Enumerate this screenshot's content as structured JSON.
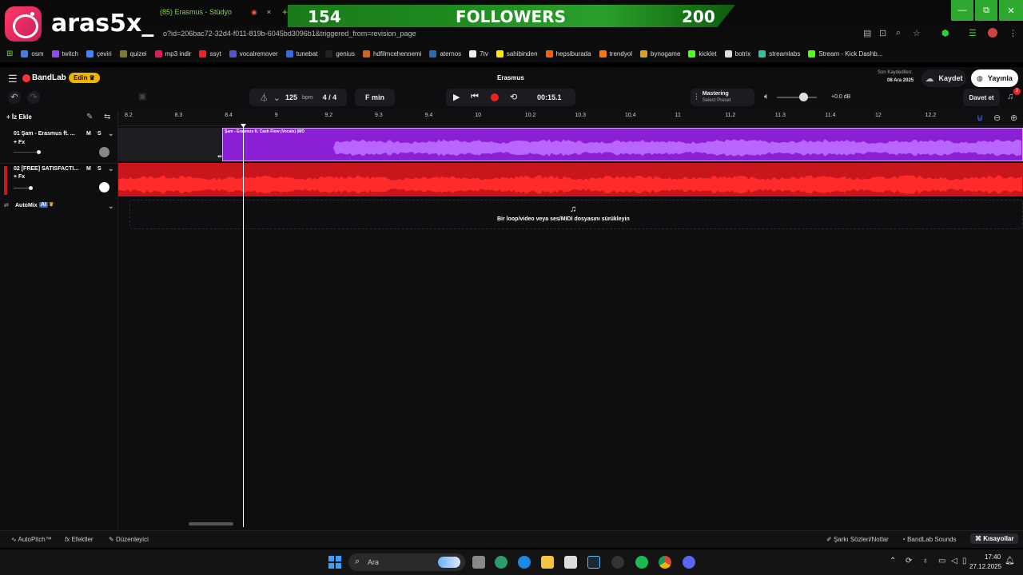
{
  "browser": {
    "tab_title": "(85) Erasmus - Stüdyo",
    "url": "o?id=206bac72-32d4-f011-819b-6045bd3096b1&triggered_from=revision_page",
    "new_tab": "+",
    "tab_close": "×",
    "min": "—",
    "max": "⧉",
    "close": "✕"
  },
  "overlay": {
    "ig_name": "aras5x_",
    "followers_current": "154",
    "followers_label": "FOLLOWERS",
    "followers_goal": "200"
  },
  "bookmarks": [
    {
      "label": "osm",
      "color": "#4a7bd8"
    },
    {
      "label": "twitch",
      "color": "#9146ff"
    },
    {
      "label": "çeviri",
      "color": "#4285f4"
    },
    {
      "label": "quizei",
      "color": "#7a7a3a"
    },
    {
      "label": "mp3 indir",
      "color": "#d81e5b"
    },
    {
      "label": "ssyt",
      "color": "#e22"
    },
    {
      "label": "vocalremover",
      "color": "#5a4fcf"
    },
    {
      "label": "tunebat",
      "color": "#3a6bd8"
    },
    {
      "label": "genius",
      "color": "#222"
    },
    {
      "label": "hdfilmcehennemi",
      "color": "#c62"
    },
    {
      "label": "aternos",
      "color": "#2a6bb8"
    },
    {
      "label": "7tv",
      "color": "#eee"
    },
    {
      "label": "sahibinden",
      "color": "#ffe800"
    },
    {
      "label": "hepsiburada",
      "color": "#ff6000"
    },
    {
      "label": "trendyol",
      "color": "#f27a1a"
    },
    {
      "label": "bynogame",
      "color": "#d8a020"
    },
    {
      "label": "kicklet",
      "color": "#53fc18"
    },
    {
      "label": "botrix",
      "color": "#ddd"
    },
    {
      "label": "streamlabs",
      "color": "#31c3a2"
    },
    {
      "label": "Stream - Kick Dashb...",
      "color": "#53fc18"
    }
  ],
  "header": {
    "logo": "BandLab",
    "edit_badge": "Edin",
    "project_title": "Erasmus",
    "last_saved_label": "Son Kaydedilen:",
    "last_saved_date": "08 Ara 2025",
    "save_button": "Kaydet",
    "publish_button": "Yayınla"
  },
  "toolbar": {
    "bpm_value": "125",
    "bpm_unit": "bpm",
    "time_sig": "4 / 4",
    "key": "F min",
    "time": "00:15.1",
    "mastering_title": "Mastering",
    "mastering_preset": "Select Preset",
    "volume_db": "+0.0 dB",
    "invite_button": "Davet et",
    "notif_count": "2"
  },
  "ruler": [
    "8.2",
    "8.3",
    "8.4",
    "9",
    "9.2",
    "9.3",
    "9.4",
    "10",
    "10.2",
    "10.3",
    "10.4",
    "11",
    "11.2",
    "11.3",
    "11.4",
    "12",
    "12.2"
  ],
  "tracks": {
    "add_track": "İz Ekle",
    "items": [
      {
        "name": "01 Şam - Erasmus ft. ...",
        "fx": "+ Fx",
        "mute": "M",
        "solo": "S",
        "color": "#8a1fd6",
        "volume": 0.45
      },
      {
        "name": "02 [FREE] SATISFACTI...",
        "fx": "+ Fx",
        "mute": "M",
        "solo": "S",
        "color": "#c8161c",
        "volume": 0.3
      }
    ],
    "automix_label": "AutoMix",
    "automix_badge": "AI"
  },
  "clips": {
    "clip1_title": "Şam - Erasmus ft. Cash Flow (Vocals) (MD"
  },
  "dropzone": {
    "text": "Bir loop/video veya ses/MIDI dosyasını sürükleyin"
  },
  "footer": {
    "autopitch": "AutoPitch™",
    "effects": "Efektler",
    "editor": "Düzenleyici",
    "lyrics": "Şarkı Sözleri/Notlar",
    "sounds": "BandLab Sounds",
    "shortcuts": "Kısayollar"
  },
  "taskbar": {
    "search": "Ara",
    "time": "17:40",
    "date": "27.12.2025"
  }
}
